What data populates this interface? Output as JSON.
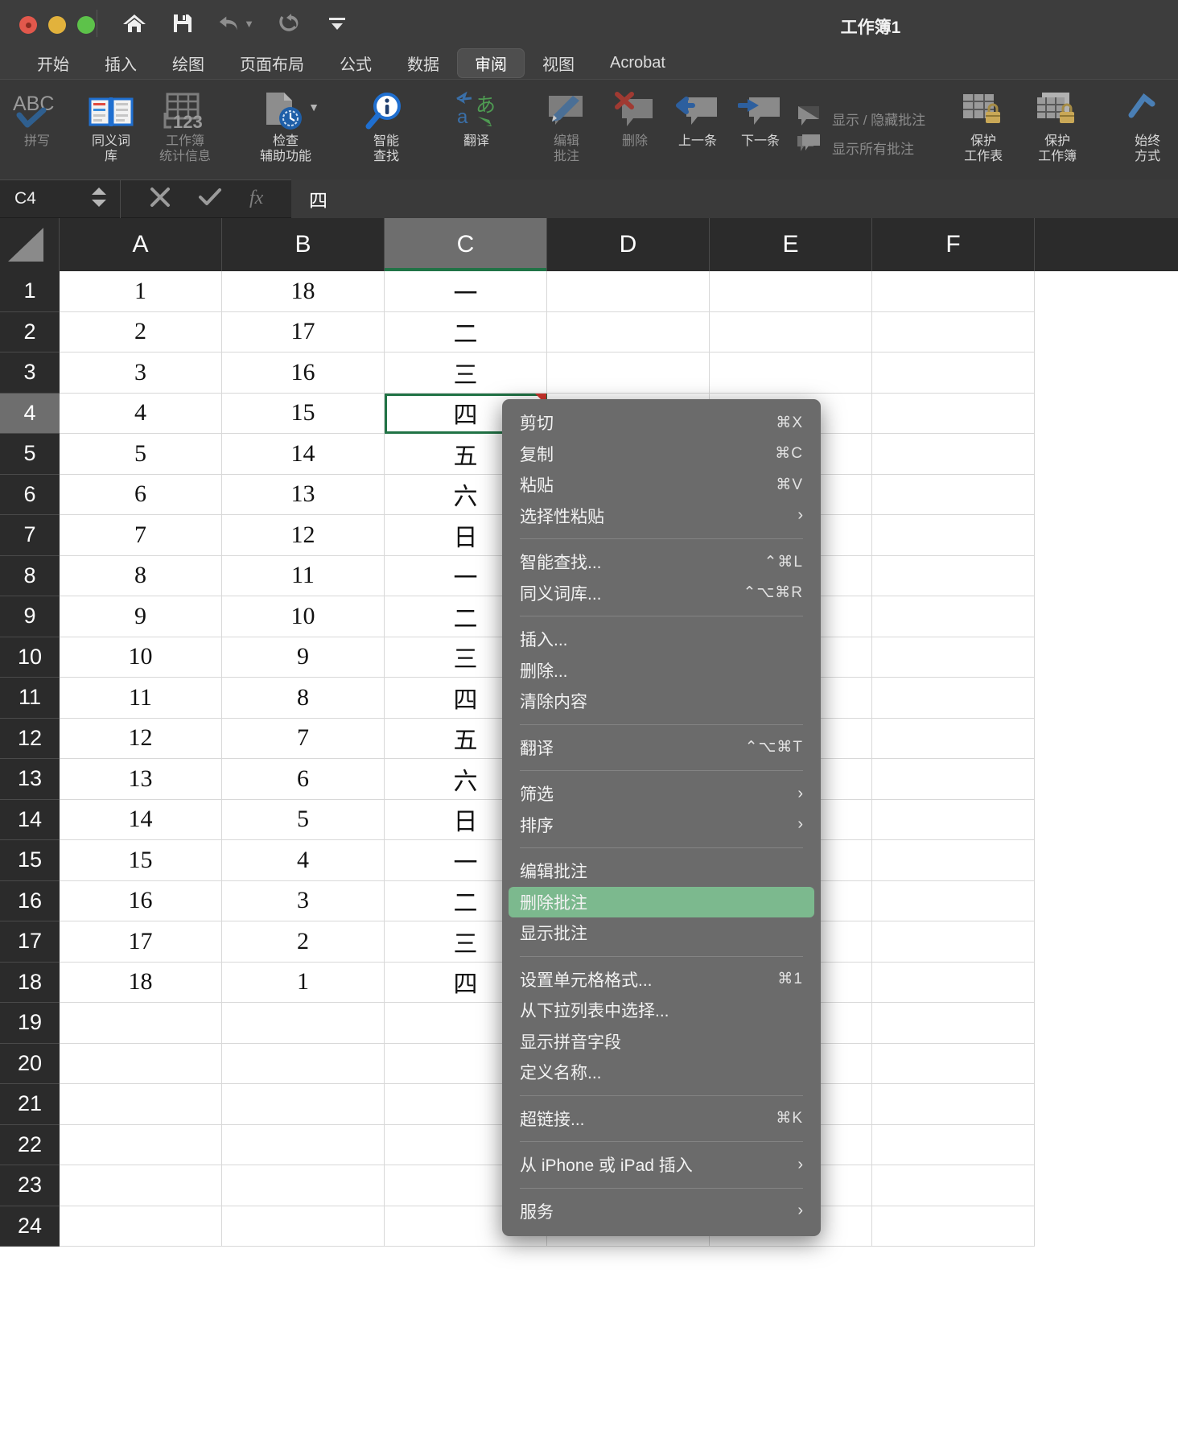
{
  "window": {
    "title": "工作簿1"
  },
  "quick_access": [
    {
      "name": "home-icon",
      "label": "主页"
    },
    {
      "name": "save-icon",
      "label": "保存"
    },
    {
      "name": "undo-icon",
      "label": "撤消"
    },
    {
      "name": "redo-icon",
      "label": "重做"
    },
    {
      "name": "customize-toolbar-icon",
      "label": "自定义工具栏"
    }
  ],
  "ribbon": {
    "tabs": [
      {
        "label": "开始",
        "active": false
      },
      {
        "label": "插入",
        "active": false
      },
      {
        "label": "绘图",
        "active": false
      },
      {
        "label": "页面布局",
        "active": false
      },
      {
        "label": "公式",
        "active": false
      },
      {
        "label": "数据",
        "active": false
      },
      {
        "label": "审阅",
        "active": true
      },
      {
        "label": "视图",
        "active": false
      },
      {
        "label": "Acrobat",
        "active": false
      }
    ],
    "groups": [
      {
        "items": [
          {
            "icon": "abc-check-icon",
            "line1": "拼写",
            "line2": "",
            "dim": true
          },
          {
            "icon": "thesaurus-book-icon",
            "line1": "同义词",
            "line2": "库",
            "dim": false
          },
          {
            "icon": "workbook-stats-icon",
            "line1": "工作簿",
            "line2": "统计信息",
            "dim": true
          }
        ]
      },
      {
        "items": [
          {
            "icon": "accessibility-check-icon",
            "line1": "检查",
            "line2": "辅助功能",
            "dim": false,
            "has_dropdown": true
          }
        ]
      },
      {
        "items": [
          {
            "icon": "smart-lookup-icon",
            "line1": "智能",
            "line2": "查找",
            "dim": false
          }
        ]
      },
      {
        "items": [
          {
            "icon": "translate-icon",
            "line1": "翻译",
            "line2": "",
            "dim": false
          }
        ]
      },
      {
        "items": [
          {
            "icon": "edit-comment-icon",
            "line1": "编辑",
            "line2": "批注",
            "dim": true
          },
          {
            "icon": "delete-comment-icon",
            "line1": "删除",
            "line2": "",
            "dim": true
          },
          {
            "icon": "previous-comment-icon",
            "line1": "上一条",
            "line2": "",
            "dim": false
          },
          {
            "icon": "next-comment-icon",
            "line1": "下一条",
            "line2": "",
            "dim": false
          }
        ],
        "rows": [
          {
            "icon": "show-hide-comment-icon",
            "label": "显示 / 隐藏批注",
            "dim": true
          },
          {
            "icon": "show-all-comments-icon",
            "label": "显示所有批注",
            "dim": true
          }
        ]
      },
      {
        "items": [
          {
            "icon": "protect-sheet-icon",
            "line1": "保护",
            "line2": "工作表",
            "dim": false
          },
          {
            "icon": "protect-workbook-icon",
            "line1": "保护",
            "line2": "工作簿",
            "dim": false
          }
        ]
      },
      {
        "items": [
          {
            "icon": "always-open-readonly-icon",
            "line1": "始终",
            "line2": "方式",
            "dim": false
          }
        ]
      }
    ]
  },
  "formula_bar": {
    "name_box": "C4",
    "cancel_icon": "cancel-icon",
    "confirm_icon": "confirm-icon",
    "function_icon": "fx-icon",
    "value": "四"
  },
  "grid": {
    "columns": [
      "A",
      "B",
      "C",
      "D",
      "E",
      "F"
    ],
    "selected_column": "C",
    "selected_row": "4",
    "active_cell": "C4",
    "rows": [
      {
        "n": "1",
        "cells": [
          "1",
          "18",
          "一",
          "",
          "",
          ""
        ]
      },
      {
        "n": "2",
        "cells": [
          "2",
          "17",
          "二",
          "",
          "",
          ""
        ]
      },
      {
        "n": "3",
        "cells": [
          "3",
          "16",
          "三",
          "",
          "",
          ""
        ]
      },
      {
        "n": "4",
        "cells": [
          "4",
          "15",
          "四",
          "",
          "",
          ""
        ]
      },
      {
        "n": "5",
        "cells": [
          "5",
          "14",
          "五",
          "",
          "",
          ""
        ]
      },
      {
        "n": "6",
        "cells": [
          "6",
          "13",
          "六",
          "",
          "",
          ""
        ]
      },
      {
        "n": "7",
        "cells": [
          "7",
          "12",
          "日",
          "",
          "",
          ""
        ]
      },
      {
        "n": "8",
        "cells": [
          "8",
          "11",
          "一",
          "",
          "",
          ""
        ]
      },
      {
        "n": "9",
        "cells": [
          "9",
          "10",
          "二",
          "",
          "",
          ""
        ]
      },
      {
        "n": "10",
        "cells": [
          "10",
          "9",
          "三",
          "",
          "",
          ""
        ]
      },
      {
        "n": "11",
        "cells": [
          "11",
          "8",
          "四",
          "",
          "",
          ""
        ]
      },
      {
        "n": "12",
        "cells": [
          "12",
          "7",
          "五",
          "",
          "",
          ""
        ]
      },
      {
        "n": "13",
        "cells": [
          "13",
          "6",
          "六",
          "",
          "",
          ""
        ]
      },
      {
        "n": "14",
        "cells": [
          "14",
          "5",
          "日",
          "",
          "",
          ""
        ]
      },
      {
        "n": "15",
        "cells": [
          "15",
          "4",
          "一",
          "",
          "",
          ""
        ]
      },
      {
        "n": "16",
        "cells": [
          "16",
          "3",
          "二",
          "",
          "",
          ""
        ]
      },
      {
        "n": "17",
        "cells": [
          "17",
          "2",
          "三",
          "",
          "",
          ""
        ]
      },
      {
        "n": "18",
        "cells": [
          "18",
          "1",
          "四",
          "",
          "",
          ""
        ]
      },
      {
        "n": "19",
        "cells": [
          "",
          "",
          "",
          "",
          "",
          ""
        ]
      },
      {
        "n": "20",
        "cells": [
          "",
          "",
          "",
          "",
          "",
          ""
        ]
      },
      {
        "n": "21",
        "cells": [
          "",
          "",
          "",
          "",
          "",
          ""
        ]
      },
      {
        "n": "22",
        "cells": [
          "",
          "",
          "",
          "",
          "",
          ""
        ]
      },
      {
        "n": "23",
        "cells": [
          "",
          "",
          "",
          "",
          "",
          ""
        ]
      },
      {
        "n": "24",
        "cells": [
          "",
          "",
          "",
          "",
          "",
          ""
        ]
      }
    ]
  },
  "context_menu": {
    "highlight_color": "#7cb98e",
    "items": [
      {
        "type": "item",
        "label": "剪切",
        "shortcut": "⌘X",
        "submenu": false,
        "highlighted": false
      },
      {
        "type": "item",
        "label": "复制",
        "shortcut": "⌘C",
        "submenu": false,
        "highlighted": false
      },
      {
        "type": "item",
        "label": "粘贴",
        "shortcut": "⌘V",
        "submenu": false,
        "highlighted": false
      },
      {
        "type": "item",
        "label": "选择性粘贴",
        "shortcut": "",
        "submenu": true,
        "highlighted": false
      },
      {
        "type": "separator"
      },
      {
        "type": "item",
        "label": "智能查找...",
        "shortcut": "⌃⌘L",
        "submenu": false,
        "highlighted": false
      },
      {
        "type": "item",
        "label": "同义词库...",
        "shortcut": "⌃⌥⌘R",
        "submenu": false,
        "highlighted": false
      },
      {
        "type": "separator"
      },
      {
        "type": "item",
        "label": "插入...",
        "shortcut": "",
        "submenu": false,
        "highlighted": false
      },
      {
        "type": "item",
        "label": "删除...",
        "shortcut": "",
        "submenu": false,
        "highlighted": false
      },
      {
        "type": "item",
        "label": "清除内容",
        "shortcut": "",
        "submenu": false,
        "highlighted": false
      },
      {
        "type": "separator"
      },
      {
        "type": "item",
        "label": "翻译",
        "shortcut": "⌃⌥⌘T",
        "submenu": false,
        "highlighted": false
      },
      {
        "type": "separator"
      },
      {
        "type": "item",
        "label": "筛选",
        "shortcut": "",
        "submenu": true,
        "highlighted": false
      },
      {
        "type": "item",
        "label": "排序",
        "shortcut": "",
        "submenu": true,
        "highlighted": false
      },
      {
        "type": "separator"
      },
      {
        "type": "item",
        "label": "编辑批注",
        "shortcut": "",
        "submenu": false,
        "highlighted": false
      },
      {
        "type": "item",
        "label": "删除批注",
        "shortcut": "",
        "submenu": false,
        "highlighted": true
      },
      {
        "type": "item",
        "label": "显示批注",
        "shortcut": "",
        "submenu": false,
        "highlighted": false
      },
      {
        "type": "separator"
      },
      {
        "type": "item",
        "label": "设置单元格格式...",
        "shortcut": "⌘1",
        "submenu": false,
        "highlighted": false
      },
      {
        "type": "item",
        "label": "从下拉列表中选择...",
        "shortcut": "",
        "submenu": false,
        "highlighted": false
      },
      {
        "type": "item",
        "label": "显示拼音字段",
        "shortcut": "",
        "submenu": false,
        "highlighted": false
      },
      {
        "type": "item",
        "label": "定义名称...",
        "shortcut": "",
        "submenu": false,
        "highlighted": false
      },
      {
        "type": "separator"
      },
      {
        "type": "item",
        "label": "超链接...",
        "shortcut": "⌘K",
        "submenu": false,
        "highlighted": false
      },
      {
        "type": "separator"
      },
      {
        "type": "item",
        "label": "从 iPhone 或 iPad 插入",
        "shortcut": "",
        "submenu": true,
        "highlighted": false
      },
      {
        "type": "separator"
      },
      {
        "type": "item",
        "label": "服务",
        "shortcut": "",
        "submenu": true,
        "highlighted": false
      }
    ]
  }
}
